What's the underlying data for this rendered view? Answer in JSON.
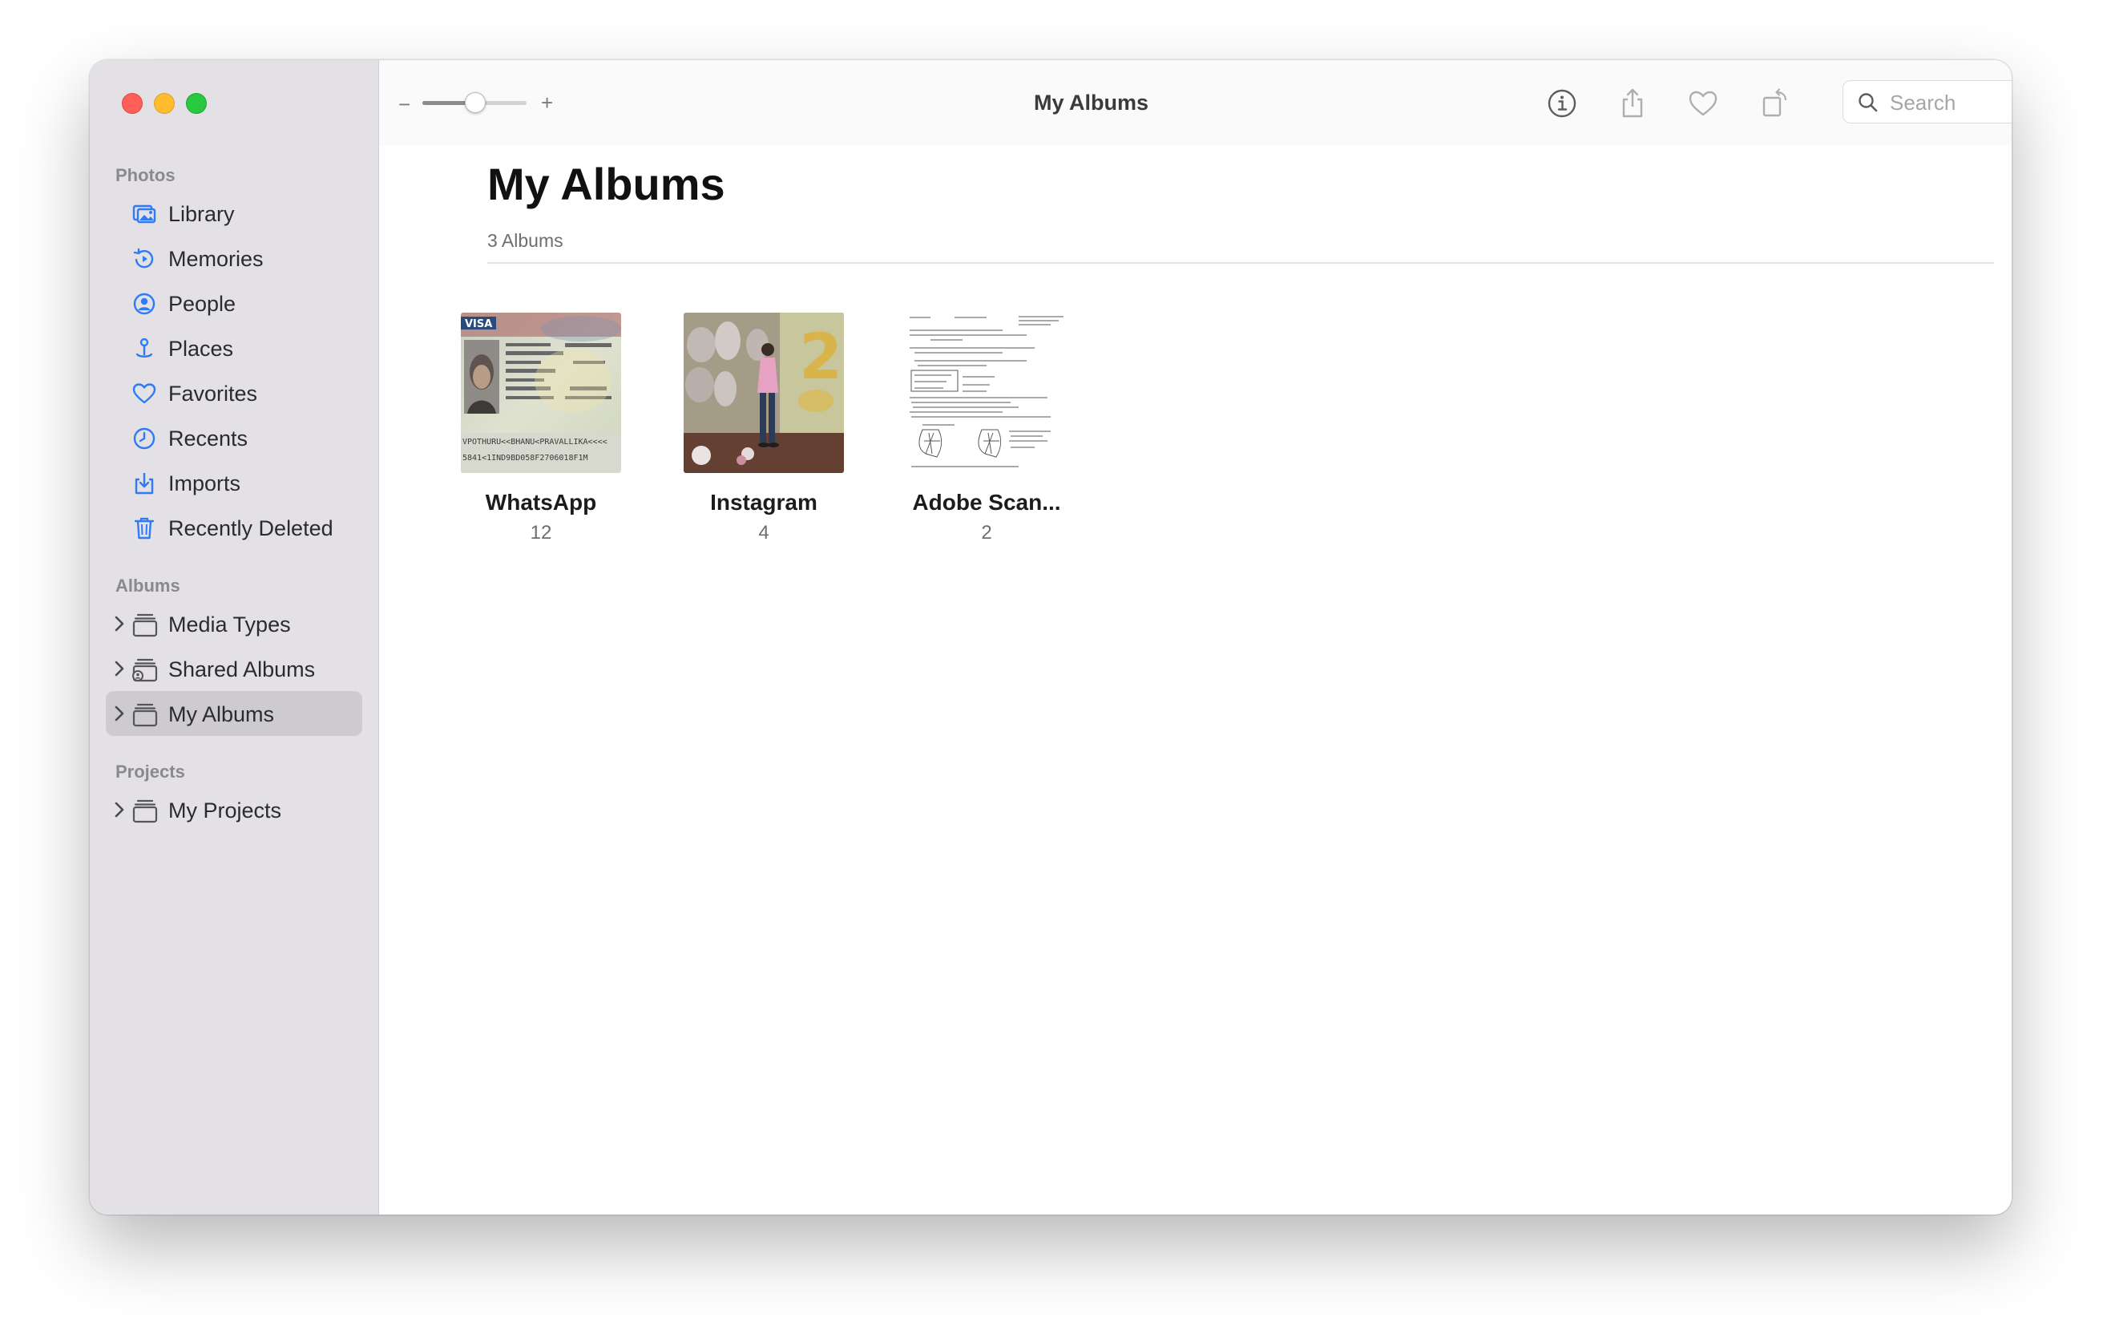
{
  "window": {
    "title": "My Albums"
  },
  "sidebar": {
    "sections": [
      {
        "header": "Photos",
        "items": [
          {
            "label": "Library",
            "icon": "library-icon"
          },
          {
            "label": "Memories",
            "icon": "memories-icon"
          },
          {
            "label": "People",
            "icon": "people-icon"
          },
          {
            "label": "Places",
            "icon": "places-icon"
          },
          {
            "label": "Favorites",
            "icon": "heart-icon"
          },
          {
            "label": "Recents",
            "icon": "clock-icon"
          },
          {
            "label": "Imports",
            "icon": "import-icon"
          },
          {
            "label": "Recently Deleted",
            "icon": "trash-icon"
          }
        ]
      },
      {
        "header": "Albums",
        "items": [
          {
            "label": "Media Types",
            "icon": "album-stack-icon"
          },
          {
            "label": "Shared Albums",
            "icon": "shared-album-icon"
          },
          {
            "label": "My Albums",
            "icon": "album-stack-icon",
            "selected": true
          }
        ]
      },
      {
        "header": "Projects",
        "items": [
          {
            "label": "My Projects",
            "icon": "album-stack-icon"
          }
        ]
      }
    ]
  },
  "toolbar": {
    "title": "My Albums",
    "zoom": {
      "minus": "−",
      "plus": "+",
      "level": 0.5
    },
    "buttons": [
      "info-icon",
      "share-icon",
      "heart-icon",
      "rotate-icon"
    ],
    "search_placeholder": "Search"
  },
  "content": {
    "title": "My Albums",
    "subtitle": "3 Albums",
    "albums": [
      {
        "name": "WhatsApp",
        "count": "12",
        "thumb": "visa-document"
      },
      {
        "name": "Instagram",
        "count": "4",
        "thumb": "party-photo"
      },
      {
        "name": "Adobe Scan...",
        "count": "2",
        "thumb": "handwritten-notes"
      }
    ]
  },
  "colors": {
    "accent": "#2f7bf6",
    "sidebar_bg": "#e3e1e5",
    "selected_bg": "#cdcbd0"
  }
}
